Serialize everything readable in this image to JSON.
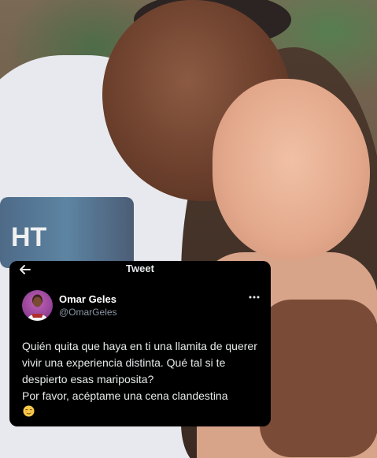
{
  "tweet": {
    "header_title": "Tweet",
    "author": {
      "display_name": "Omar Geles",
      "handle": "@OmarGeles"
    },
    "text": "Quién quita que haya en ti una llamita de querer vivir una experiencia distinta. Qué tal si te despierto esas mariposita?\nPor favor, acéptame una cena clandestina",
    "emoji": "relieved-face-icon"
  },
  "photo_shirt_print_text": "HT",
  "colors": {
    "card_background": "#000000",
    "text_primary": "#e7e9ea",
    "text_secondary": "#8b98a5",
    "avatar_accent": "#a34aa0"
  }
}
